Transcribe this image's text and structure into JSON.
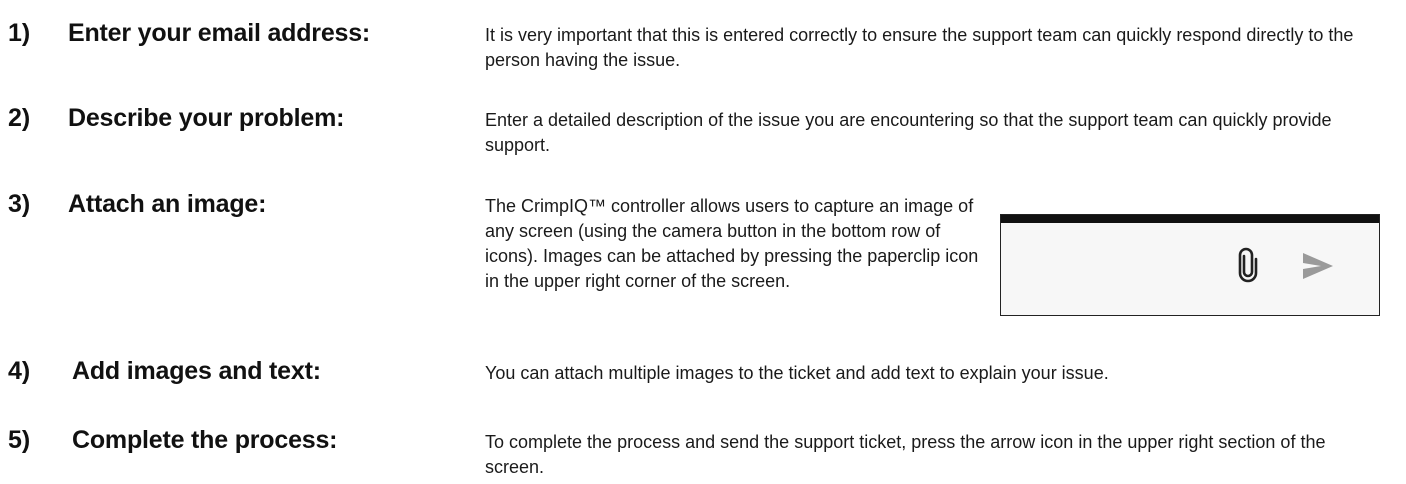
{
  "steps": [
    {
      "number": "1)",
      "title": "Enter your email address:",
      "description": "It is very important that this is entered correctly to ensure the support team can quickly respond directly to the person having the issue."
    },
    {
      "number": "2)",
      "title": "Describe your problem:",
      "description": "Enter a detailed description of the issue you are encountering so that the support team can quickly provide support."
    },
    {
      "number": "3)",
      "title": "Attach an image:",
      "description": "The CrimpIQ™ controller allows users to capture an image of any screen (using the camera button in the bottom row of icons). Images can be attached by pressing the paperclip icon in the upper right corner of the screen."
    },
    {
      "number": "4)",
      "title": "Add images and text:",
      "description": "You can attach multiple images to the ticket and add text to explain your issue."
    },
    {
      "number": "5)",
      "title": "Complete the process:",
      "description": "To complete the process and send the support ticket, press the arrow icon in the upper right section of the screen."
    }
  ],
  "toolbar_example": {
    "icons": [
      "paperclip-icon",
      "send-arrow-icon"
    ],
    "icon_color": "#9a9a9a",
    "bar_color": "#111111"
  }
}
